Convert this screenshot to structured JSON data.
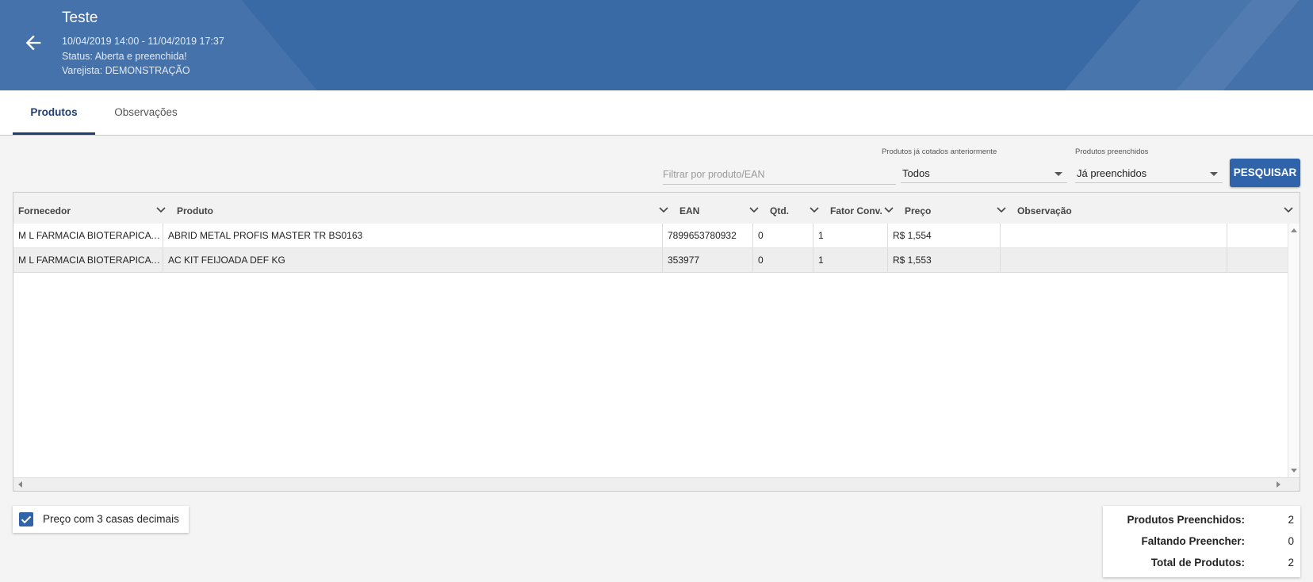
{
  "header": {
    "title": "Teste",
    "period": "10/04/2019 14:00 - 11/04/2019 17:37",
    "status": "Status: Aberta e preenchida!",
    "retailer": "Varejista: DEMONSTRAÇÃO",
    "back_icon": "arrow-left-icon"
  },
  "tabs": [
    {
      "label": "Produtos",
      "active": true
    },
    {
      "label": "Observações",
      "active": false
    }
  ],
  "filters": {
    "search_placeholder": "Filtrar por produto/EAN",
    "search_value": "",
    "quoted_label": "Produtos já cotados anteriormente",
    "quoted_value": "Todos",
    "filled_label": "Produtos preenchidos",
    "filled_value": "Já preenchidos",
    "search_button": "PESQUISAR"
  },
  "grid": {
    "columns": [
      "Fornecedor",
      "Produto",
      "EAN",
      "Qtd.",
      "Fator Conv.",
      "Preço",
      "Observação"
    ],
    "rows": [
      [
        "M L FARMACIA BIOTERAPICA LTDA",
        "ABRID METAL PROFIS MASTER TR BS0163",
        "7899653780932",
        "0",
        "1",
        "R$ 1,554",
        ""
      ],
      [
        "M L FARMACIA BIOTERAPICA LTDA",
        "AC KIT FEIJOADA DEF KG",
        "353977",
        "0",
        "1",
        "R$ 1,553",
        ""
      ]
    ]
  },
  "checkbox": {
    "label": "Preço com 3 casas decimais",
    "checked": true
  },
  "totals": {
    "filled_label": "Produtos Preenchidos:",
    "filled_value": "2",
    "missing_label": "Faltando Preencher:",
    "missing_value": "0",
    "total_label": "Total de Produtos:",
    "total_value": "2"
  },
  "colors": {
    "header_bg": "#3a6aa6",
    "accent": "#2f63aa",
    "tab_active": "#1e3f74"
  }
}
